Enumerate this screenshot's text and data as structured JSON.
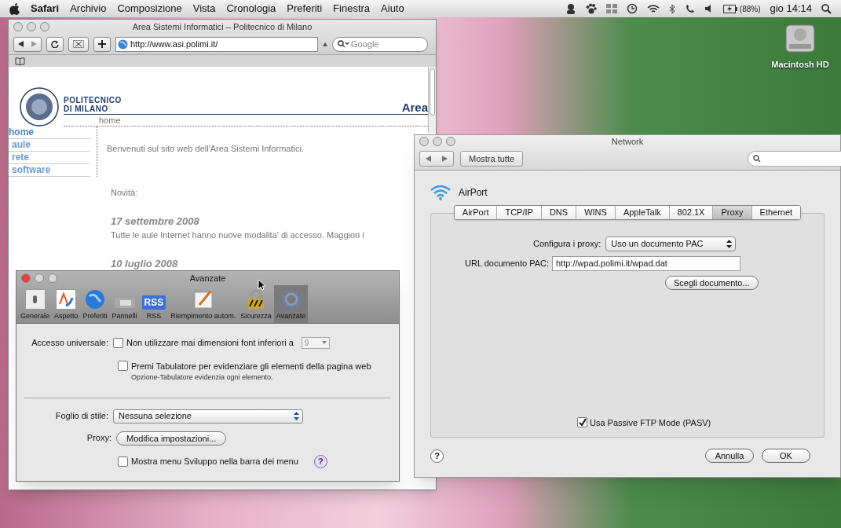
{
  "menu_bar": {
    "app": "Safari",
    "menus": [
      "Archivio",
      "Composizione",
      "Vista",
      "Cronologia",
      "Preferiti",
      "Finestra",
      "Aiuto"
    ],
    "battery": "(88%)",
    "clock": "gio 14:14"
  },
  "desktop_icon": {
    "label": "Macintosh HD"
  },
  "safari": {
    "title": "Area Sistemi Informatici – Politecnico di Milano",
    "url": "http://www.asi.polimi.it/",
    "search": {
      "placeholder": "Google"
    },
    "page": {
      "logo_lines": [
        "POLITECNICO",
        "DI MILANO"
      ],
      "header": "Area",
      "breadcrumb": "home",
      "nav": [
        {
          "label": "home",
          "selected": true
        },
        {
          "label": "aule",
          "selected": false
        },
        {
          "label": "rete",
          "selected": false
        },
        {
          "label": "software",
          "selected": false
        }
      ],
      "welcome": "Benvenuti sul sito web dell'Area Sistemi Informatici.",
      "news_heading": "Novità:",
      "news": [
        {
          "date": "17 settembre 2008",
          "text": "Tutte le aule Internet hanno nuove modalita' di accesso. Maggiori i"
        },
        {
          "date": "10 luglio 2008"
        }
      ]
    }
  },
  "prefs": {
    "title": "Avanzate",
    "toolbar": [
      {
        "kind": "switch",
        "label": "Generale",
        "selected": false
      },
      {
        "kind": "font",
        "label": "Aspetto",
        "selected": false
      },
      {
        "kind": "globe",
        "label": "Preferiti",
        "selected": false
      },
      {
        "kind": "tabs",
        "label": "Pannelli",
        "selected": false
      },
      {
        "kind": "rss",
        "label": "RSS",
        "icon_text": "RSS",
        "selected": false
      },
      {
        "kind": "pencil",
        "label": "Riempimento autom.",
        "selected": false
      },
      {
        "kind": "lock",
        "label": "Sicurezza",
        "selected": false
      },
      {
        "kind": "gear",
        "label": "Avanzate",
        "selected": true
      }
    ],
    "accessibility_label": "Accesso universale:",
    "min_font": {
      "label": "Non utilizzare mai dimensioni font inferiori a",
      "checked": false,
      "value": "9"
    },
    "tab_highlight": {
      "label": "Premi Tabulatore per evidenziare gli elementi della pagina web",
      "checked": false,
      "hint": "Opzione-Tabulatore evidenzia ogni elemento."
    },
    "stylesheet": {
      "label": "Foglio di stile:",
      "value": "Nessuna selezione"
    },
    "proxy": {
      "label": "Proxy:",
      "button": "Modifica impostazioni..."
    },
    "develop_menu": {
      "label": "Mostra menu Sviluppo nella barra dei menu",
      "checked": false
    },
    "help": "?"
  },
  "network": {
    "title": "Network",
    "show_all": "Mostra tutte",
    "service": "AirPort",
    "tabs": [
      {
        "label": "AirPort",
        "selected": false
      },
      {
        "label": "TCP/IP",
        "selected": false
      },
      {
        "label": "DNS",
        "selected": false
      },
      {
        "label": "WINS",
        "selected": false
      },
      {
        "label": "AppleTalk",
        "selected": false
      },
      {
        "label": "802.1X",
        "selected": false
      },
      {
        "label": "Proxy",
        "selected": true
      },
      {
        "label": "Ethernet",
        "selected": false
      }
    ],
    "configure": {
      "label": "Configura i proxy:",
      "value": "Uso un documento PAC"
    },
    "pac_url": {
      "label": "URL documento PAC:",
      "value": "http://wpad.polimi.it/wpad.dat"
    },
    "choose_button": "Scegli documento...",
    "passive_ftp": {
      "label": "Usa Passive FTP Mode (PASV)",
      "checked": true
    },
    "help": "?",
    "buttons": [
      {
        "kind": "cancel",
        "label": "Annulla"
      },
      {
        "kind": "default",
        "label": "OK"
      }
    ]
  }
}
